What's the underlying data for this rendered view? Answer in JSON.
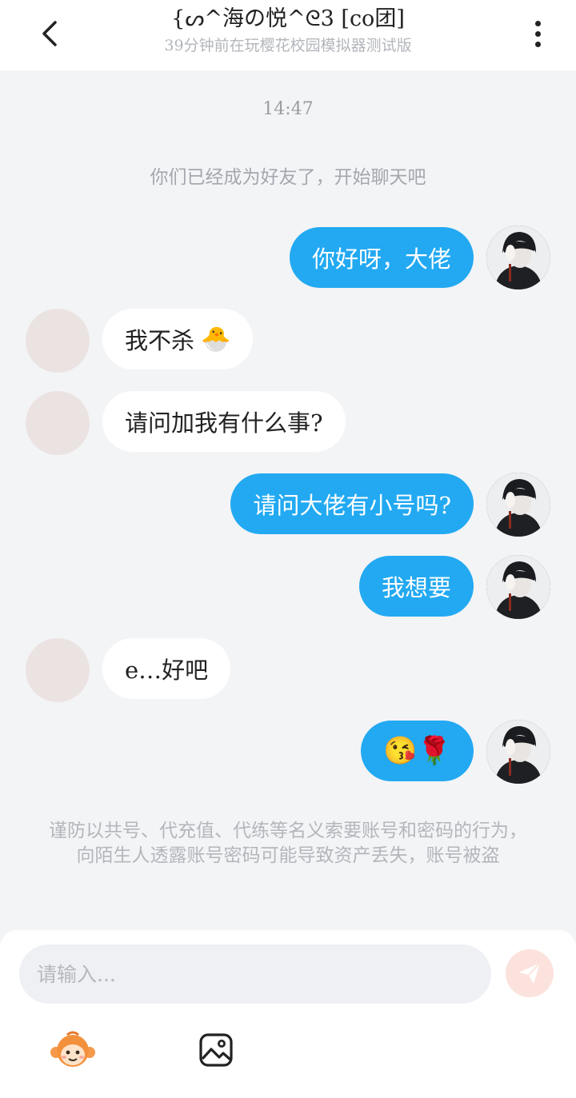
{
  "header": {
    "title": "{ᔕ^海の悦^ᘓ3 [co团]",
    "subtitle": "39分钟前在玩樱花校园模拟器测试版"
  },
  "chat": {
    "timestamp": "14:47",
    "system_note": "你们已经成为好友了，开始聊天吧",
    "messages": [
      {
        "sender": "me",
        "text": "你好呀，大佬"
      },
      {
        "sender": "other",
        "text": "我不杀",
        "emoji": "🐣"
      },
      {
        "sender": "other",
        "text": "请问加我有什么事?"
      },
      {
        "sender": "me",
        "text": "请问大佬有小号吗?"
      },
      {
        "sender": "me",
        "text": "我想要"
      },
      {
        "sender": "other",
        "text": "e…好吧"
      },
      {
        "sender": "me",
        "text": "",
        "emoji": "😘🌹"
      }
    ],
    "warning": "谨防以共号、代充值、代练等名义索要账号和密码的行为，向陌生人透露账号密码可能导致资产丢失，账号被盗"
  },
  "input": {
    "placeholder": "请输入..."
  },
  "colors": {
    "my_bubble": "#22a9f2",
    "other_bubble": "#ffffff",
    "background": "#f3f4f6",
    "send_button": "#fbe2dc"
  },
  "icons": {
    "back": "chevron-left-icon",
    "more": "more-vertical-icon",
    "send": "paper-plane-icon",
    "sticker": "monkey-sticker-icon",
    "image": "image-icon"
  }
}
